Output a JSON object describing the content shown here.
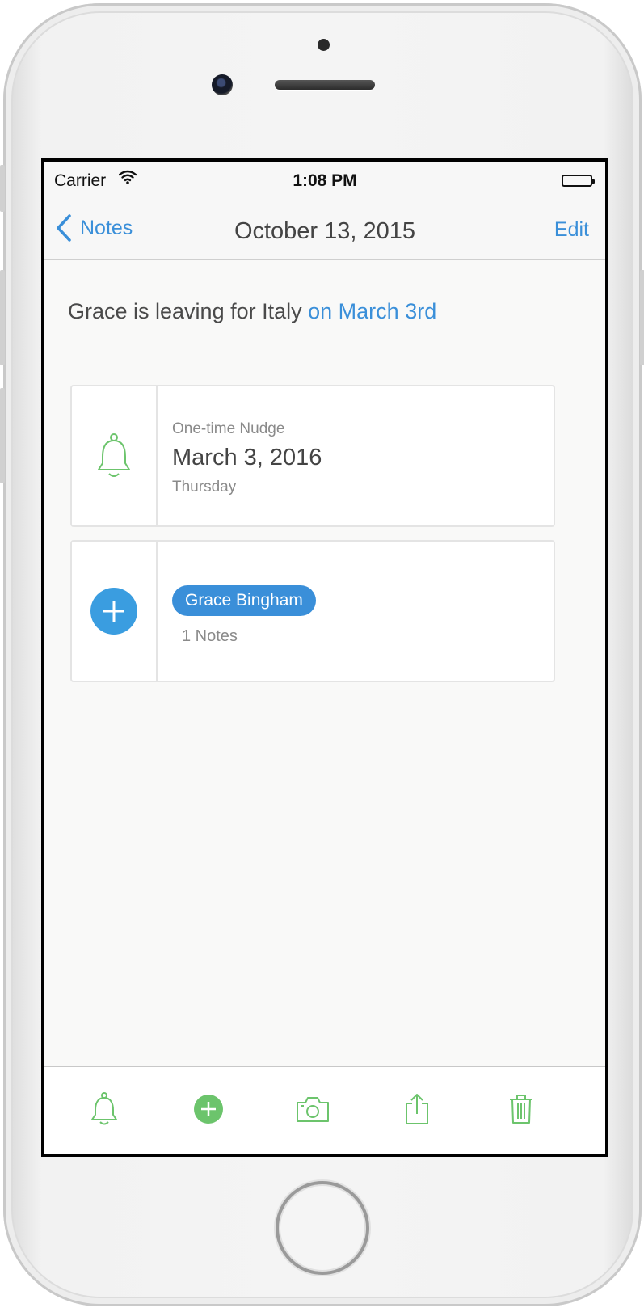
{
  "status_bar": {
    "carrier": "Carrier",
    "time": "1:08 PM"
  },
  "nav": {
    "back_label": "Notes",
    "title": "October 13, 2015",
    "edit_label": "Edit"
  },
  "note": {
    "text": "Grace is leaving for Italy",
    "highlight": "on March 3rd"
  },
  "nudge": {
    "type_label": "One-time Nudge",
    "date": "March 3, 2016",
    "weekday": "Thursday",
    "icon": "bell-icon"
  },
  "contact": {
    "name": "Grace Bingham",
    "notes_count": "1 Notes",
    "icon": "plus-circle-icon"
  },
  "toolbar": {
    "items": [
      "bell-icon",
      "add-icon",
      "camera-icon",
      "share-icon",
      "trash-icon"
    ]
  },
  "colors": {
    "accent_blue": "#3a8fd9",
    "icon_green": "#6cc46c",
    "background": "#f9f9f8"
  }
}
